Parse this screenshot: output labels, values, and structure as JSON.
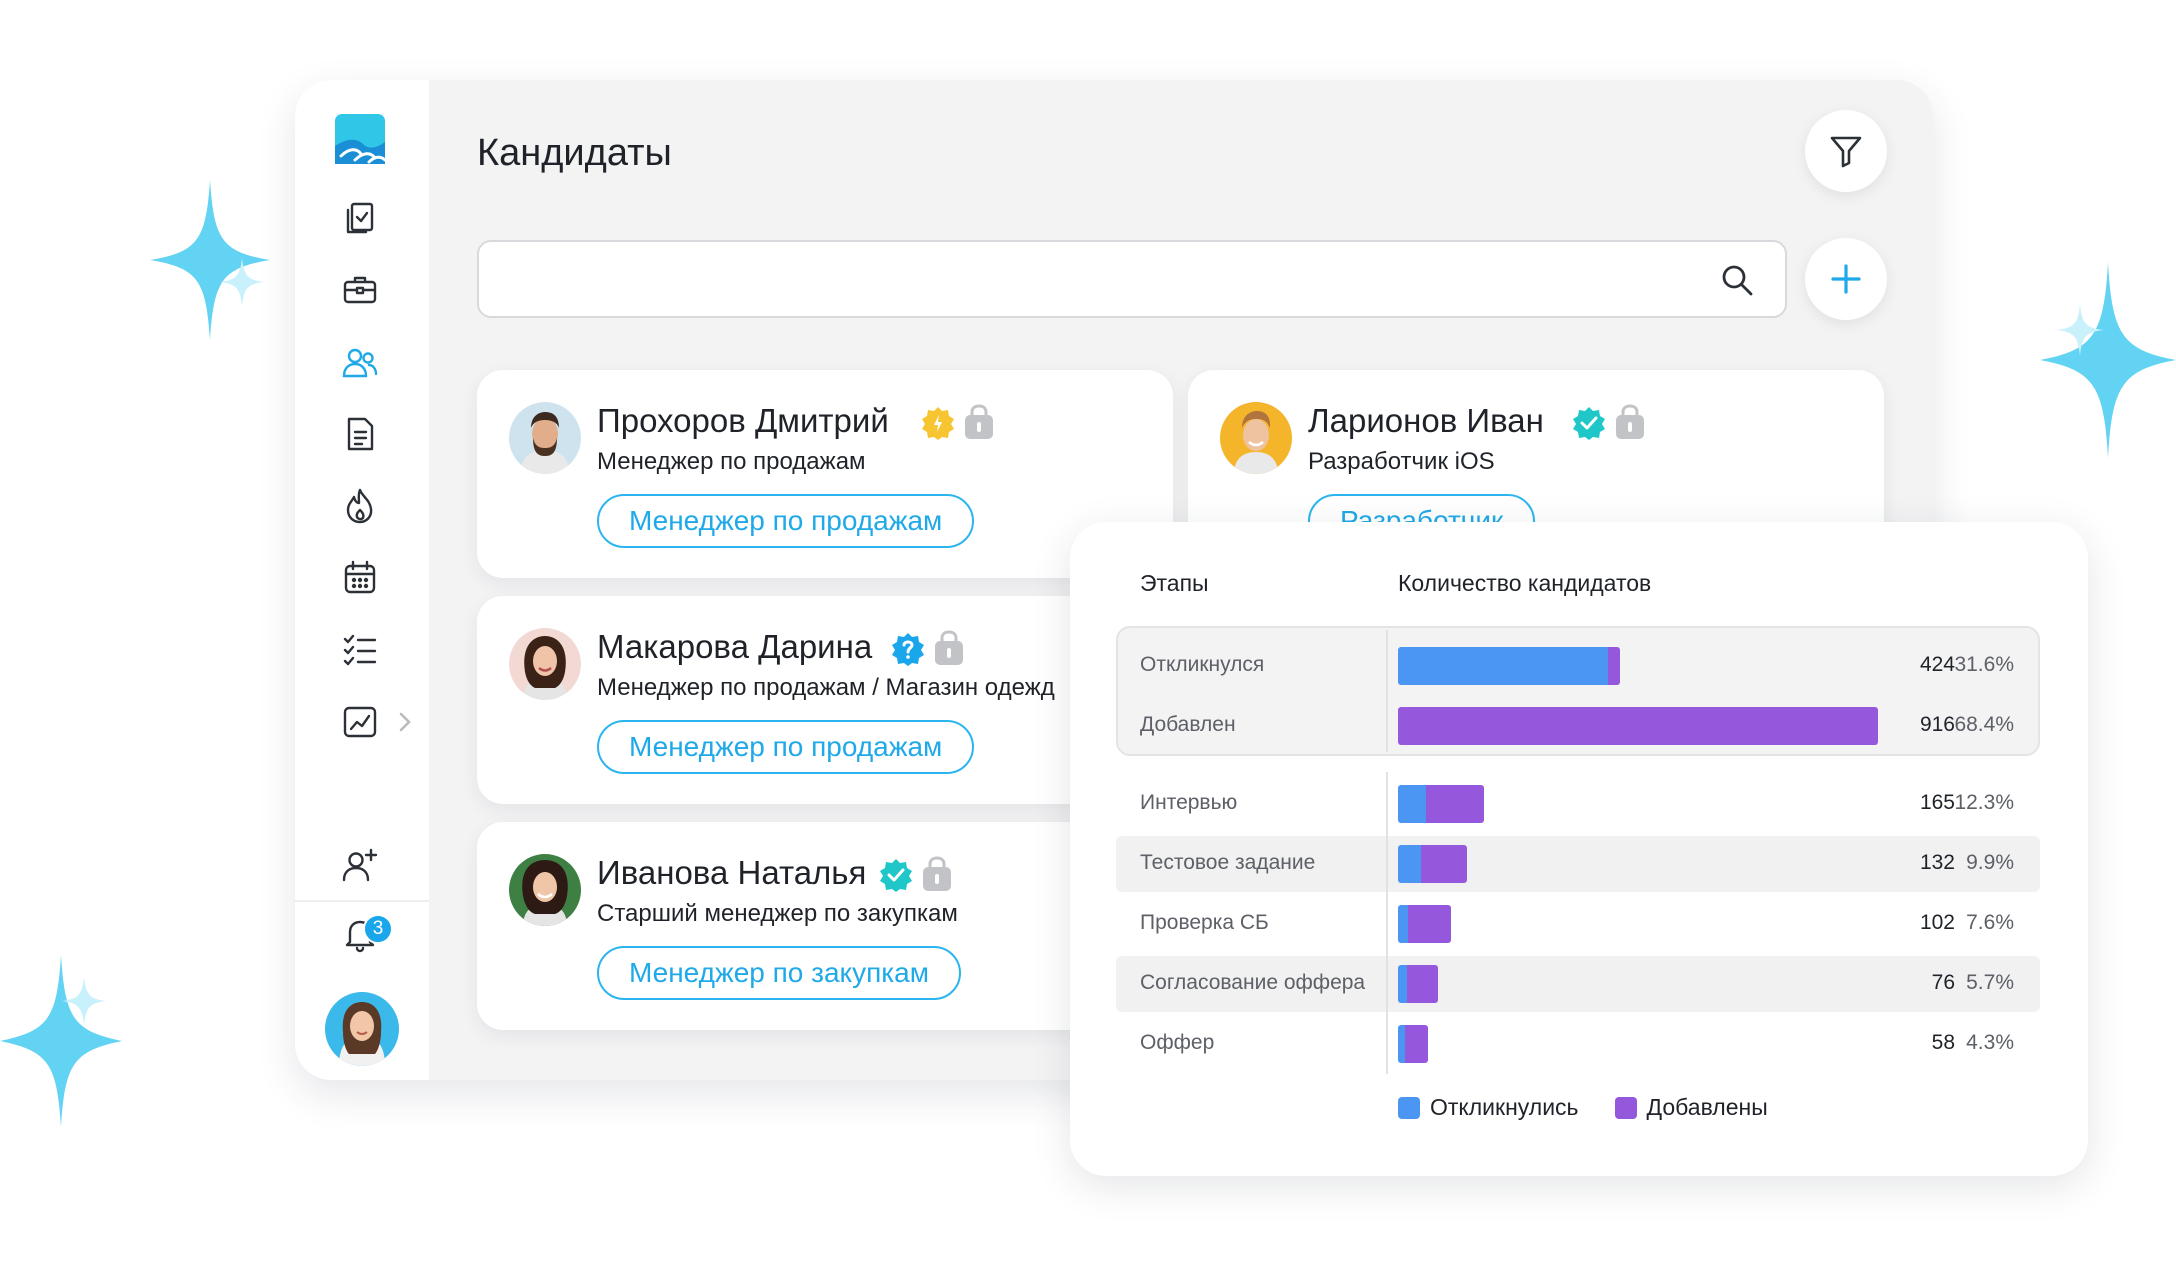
{
  "page": {
    "title": "Кандидаты"
  },
  "search": {
    "placeholder": ""
  },
  "notifications": {
    "count": "3"
  },
  "colors": {
    "accent": "#1fa9e8",
    "responded": "#4b96f3",
    "added": "#9558dc",
    "verified": "#1fc7c9",
    "pending": "#f7c531",
    "question": "#1aa6ea"
  },
  "sidebar": {
    "items": [
      {
        "icon": "clipboard-check-icon"
      },
      {
        "icon": "briefcase-icon"
      },
      {
        "icon": "users-icon",
        "active": true
      },
      {
        "icon": "document-icon"
      },
      {
        "icon": "fire-icon"
      },
      {
        "icon": "calendar-icon"
      },
      {
        "icon": "checklist-icon"
      },
      {
        "icon": "analytics-icon"
      }
    ],
    "bottom": [
      {
        "icon": "add-user-icon"
      },
      {
        "icon": "bell-icon"
      }
    ]
  },
  "candidates": [
    {
      "name": "Прохоров Дмитрий",
      "role": "Менеджер по продажам",
      "tag": "Менеджер по продажам",
      "status": "pending"
    },
    {
      "name": "Ларионов  Иван",
      "role": "Разработчик iOS",
      "tag": "Разработчик",
      "status": "verified"
    },
    {
      "name": "Макарова Дарина",
      "role": "Менеджер по продажам / Магазин одежд",
      "tag": "Менеджер по продажам",
      "status": "question"
    },
    {
      "name": "Иванова Наталья",
      "role": "Старший менеджер по закупкам",
      "tag": "Менеджер по закупкам",
      "status": "verified"
    }
  ],
  "stats": {
    "col_stage": "Этапы",
    "col_count": "Количество кандидатов",
    "legend": {
      "responded": "Откликнулись",
      "added": "Добавлены"
    }
  },
  "chart_data": {
    "type": "bar",
    "orientation": "horizontal",
    "stacked": true,
    "categories": [
      "Откликнулся",
      "Добавлен",
      "Интервью",
      "Тестовое задание",
      "Проверка СБ",
      "Согласование оффера",
      "Оффер"
    ],
    "totals": [
      424,
      916,
      165,
      132,
      102,
      76,
      58
    ],
    "totals_display": [
      "424",
      "916",
      "165",
      "132",
      "102",
      "76",
      "58"
    ],
    "percents": [
      "31.6%",
      "68.4%",
      "12.3%",
      "9.9%",
      "7.6%",
      "5.7%",
      "4.3%"
    ],
    "series": [
      {
        "name": "Откликнулись",
        "values": [
          400,
          0,
          53,
          43,
          20,
          17,
          14
        ]
      },
      {
        "name": "Добавлены",
        "values": [
          24,
          916,
          112,
          89,
          82,
          59,
          44
        ]
      }
    ],
    "xlim": [
      0,
      916
    ]
  }
}
